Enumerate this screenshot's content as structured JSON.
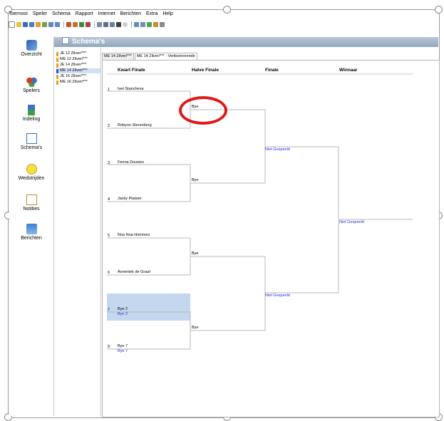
{
  "menu": [
    "Toernooi",
    "Speler",
    "Schema",
    "Rapport",
    "Internet",
    "Berichten",
    "Extra",
    "Help"
  ],
  "window_title": "Schema's",
  "nav": [
    "Overzicht",
    "Spelers",
    "Indeling",
    "Schema's",
    "Wedstrijden",
    "Notities",
    "Berichten"
  ],
  "categories": [
    {
      "label": "JE 12 Zilver/***",
      "color": "#e6a020",
      "selected": false
    },
    {
      "label": "ME 12 Zilver/***",
      "color": "#e6a020",
      "selected": false
    },
    {
      "label": "JE 14 Zilver/***",
      "color": "#e6a020",
      "selected": false
    },
    {
      "label": "ME 14 Zilver/***",
      "color": "#2a5ac8",
      "selected": true
    },
    {
      "label": "JE 16 Zilver/***",
      "color": "#e6a020",
      "selected": false
    },
    {
      "label": "ME 16 Zilver/***",
      "color": "#e6a020",
      "selected": false
    }
  ],
  "tabs": [
    "ME 14 Zilver/***",
    "ME 14 Zilver/*** - Verliezersronde"
  ],
  "columns": [
    "Kwart Finale",
    "Halve Finale",
    "Finale",
    "Winnaar"
  ],
  "players": [
    {
      "num": "1",
      "name": "Ivet Stancheva",
      "sub": ""
    },
    {
      "num": "2",
      "name": "Robynn Sterenberg",
      "sub": ""
    },
    {
      "num": "3",
      "name": "Fenna Douwes",
      "sub": ""
    },
    {
      "num": "4",
      "name": "Jacky Plaisier",
      "sub": ""
    },
    {
      "num": "5",
      "name": "Noa Noa Hommes",
      "sub": ""
    },
    {
      "num": "6",
      "name": "Anneniek de Graaf",
      "sub": ""
    },
    {
      "num": "7",
      "name": "Bye 2",
      "sub": "Bye 2"
    },
    {
      "num": "8",
      "name": "Bye 7",
      "sub": "Bye 7"
    }
  ],
  "semis": [
    "Bye",
    "Bye",
    "Bye",
    "Bye"
  ],
  "finals": [
    "Niet Gespeeld",
    "Niet Gespeeld"
  ],
  "winner": "Niet Gespeeld"
}
